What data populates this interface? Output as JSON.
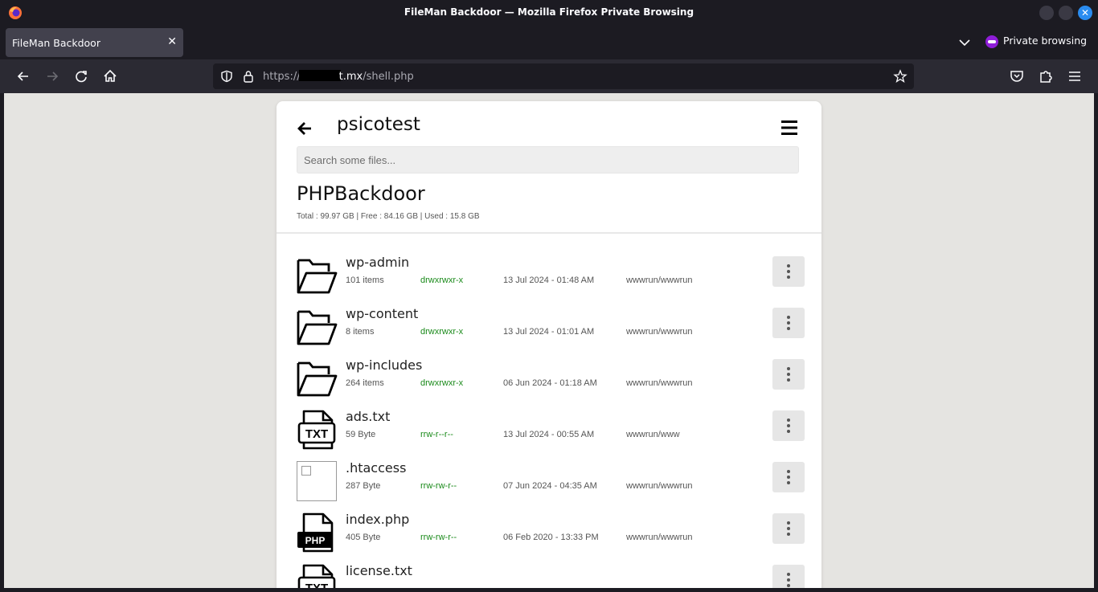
{
  "window": {
    "title": "FileMan Backdoor — Mozilla Firefox Private Browsing"
  },
  "tab": {
    "label": "FileMan Backdoor",
    "close": "✕"
  },
  "private": {
    "label": "Private browsing"
  },
  "url": {
    "scheme": "https://",
    "host_tail": "t.mx",
    "path": "/shell.php"
  },
  "page": {
    "folder_name": "psicotest",
    "search_placeholder": "Search some files...",
    "app_title": "PHPBackdoor",
    "stats": "Total : 99.97 GB  |  Free : 84.16 GB  |  Used : 15.8 GB"
  },
  "files": [
    {
      "name": "wp-admin",
      "size": "101 items",
      "perm": "drwxrwxr-x",
      "date": "13 Jul 2024 - 01:48 AM",
      "owner": "wwwrun/wwwrun",
      "icon": "folder-icon"
    },
    {
      "name": "wp-content",
      "size": "8 items",
      "perm": "drwxrwxr-x",
      "date": "13 Jul 2024 - 01:01 AM",
      "owner": "wwwrun/wwwrun",
      "icon": "folder-icon"
    },
    {
      "name": "wp-includes",
      "size": "264 items",
      "perm": "drwxrwxr-x",
      "date": "06 Jun 2024 - 01:18 AM",
      "owner": "wwwrun/wwwrun",
      "icon": "folder-icon"
    },
    {
      "name": "ads.txt",
      "size": "59 Byte",
      "perm": "rrw-r--r--",
      "date": "13 Jul 2024 - 00:55 AM",
      "owner": "wwwrun/www",
      "icon": "txt-file-icon"
    },
    {
      "name": ".htaccess",
      "size": "287 Byte",
      "perm": "rrw-rw-r--",
      "date": "07 Jun 2024 - 04:35 AM",
      "owner": "wwwrun/wwwrun",
      "icon": "broken-image-icon"
    },
    {
      "name": "index.php",
      "size": "405 Byte",
      "perm": "rrw-rw-r--",
      "date": "06 Feb 2020 - 13:33 PM",
      "owner": "wwwrun/wwwrun",
      "icon": "php-file-icon"
    },
    {
      "name": "license.txt",
      "size": "",
      "perm": "",
      "date": "",
      "owner": "",
      "icon": "txt-file-icon"
    }
  ],
  "icon_labels": {
    "txt": "TXT",
    "php": "PHP"
  }
}
